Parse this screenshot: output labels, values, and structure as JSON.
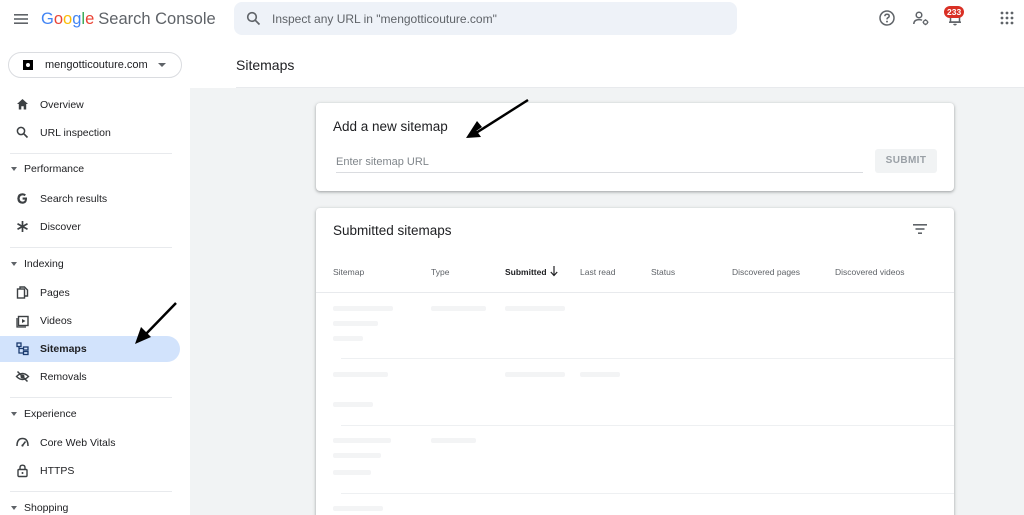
{
  "header": {
    "logo_letters": [
      "G",
      "o",
      "o",
      "g",
      "l",
      "e"
    ],
    "product": "Search Console",
    "search_placeholder": "Inspect any URL in \"mengotticouture.com\"",
    "notification_count": "233"
  },
  "sidebar": {
    "property": "mengotticouture.com",
    "items": [
      {
        "label": "Overview",
        "icon": "home-icon"
      },
      {
        "label": "URL inspection",
        "icon": "search-icon"
      }
    ],
    "sections": [
      {
        "label": "Performance",
        "items": [
          {
            "label": "Search results",
            "icon": "google-g-icon"
          },
          {
            "label": "Discover",
            "icon": "asterisk-icon"
          }
        ]
      },
      {
        "label": "Indexing",
        "items": [
          {
            "label": "Pages",
            "icon": "pages-icon"
          },
          {
            "label": "Videos",
            "icon": "video-icon"
          },
          {
            "label": "Sitemaps",
            "icon": "sitemap-icon",
            "active": true
          },
          {
            "label": "Removals",
            "icon": "eye-off-icon"
          }
        ]
      },
      {
        "label": "Experience",
        "items": [
          {
            "label": "Core Web Vitals",
            "icon": "gauge-icon"
          },
          {
            "label": "HTTPS",
            "icon": "lock-icon"
          }
        ]
      },
      {
        "label": "Shopping"
      }
    ]
  },
  "main": {
    "page_title": "Sitemaps",
    "add_card": {
      "title": "Add a new sitemap",
      "input_placeholder": "Enter sitemap URL",
      "submit_label": "SUBMIT"
    },
    "submitted_card": {
      "title": "Submitted sitemaps",
      "columns": [
        "Sitemap",
        "Type",
        "Submitted",
        "Last read",
        "Status",
        "Discovered pages",
        "Discovered videos"
      ],
      "sorted_column": "Submitted"
    }
  },
  "colors": {
    "active_nav": "#d2e3fc",
    "search_bg": "#eef2f8",
    "badge": "#d93025",
    "main_bg": "#f1f3f4"
  }
}
